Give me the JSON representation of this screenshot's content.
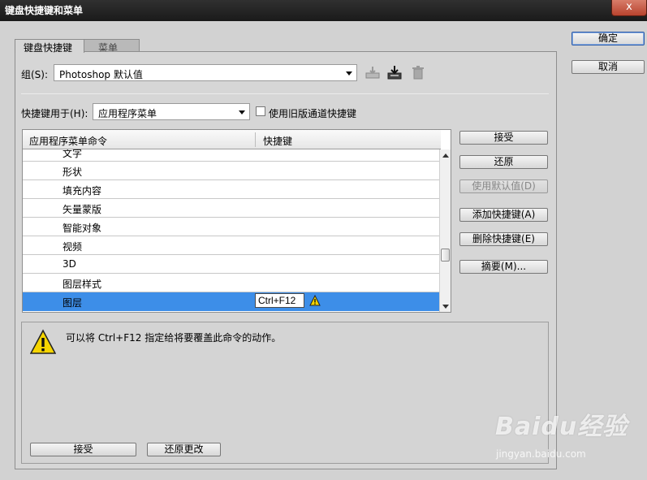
{
  "window": {
    "title": "键盘快捷键和菜单",
    "close_label": "x"
  },
  "tabs": [
    {
      "label": "键盘快捷键"
    },
    {
      "label": "菜单"
    }
  ],
  "group": {
    "label": "组(S):",
    "value": "Photoshop 默认值"
  },
  "shortcuts_for": {
    "label": "快捷键用于(H):",
    "value": "应用程序菜单",
    "legacy_checkbox_label": "使用旧版通道快捷键",
    "legacy_checked": false
  },
  "table": {
    "headers": [
      "应用程序菜单命令",
      "快捷键"
    ],
    "rows": [
      {
        "name": "文字",
        "shortcut": ""
      },
      {
        "name": "形状",
        "shortcut": ""
      },
      {
        "name": "填充内容",
        "shortcut": ""
      },
      {
        "name": "矢量蒙版",
        "shortcut": ""
      },
      {
        "name": "智能对象",
        "shortcut": ""
      },
      {
        "name": "视频",
        "shortcut": ""
      },
      {
        "name": "3D",
        "shortcut": ""
      },
      {
        "name": "图层样式",
        "shortcut": ""
      },
      {
        "name": "图层",
        "shortcut": "Ctrl+F12"
      }
    ],
    "selected_index": 8
  },
  "side_buttons": {
    "ok": "确定",
    "cancel": "取消",
    "accept": "接受",
    "undo": "还原",
    "use_default": "使用默认值(D)",
    "add_shortcut": "添加快捷键(A)",
    "delete_shortcut": "删除快捷键(E)",
    "summarize": "摘要(M)..."
  },
  "message": {
    "text": "可以将 Ctrl+F12 指定给将要覆盖此命令的动作。",
    "accept": "接受",
    "undo_changes": "还原更改"
  },
  "watermark": {
    "brand": "Baidu经验",
    "url": "jingyan.baidu.com"
  },
  "colors": {
    "selection": "#3d8ee8",
    "titlebar": "#1a1a1a",
    "close_button": "#c24d36"
  }
}
